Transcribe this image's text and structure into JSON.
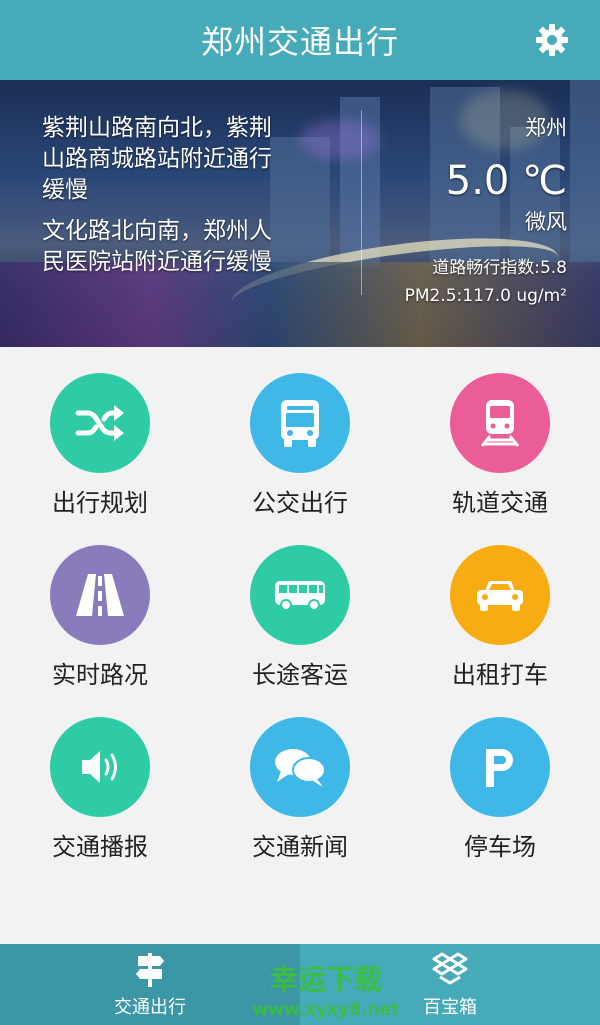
{
  "header": {
    "title": "郑州交通出行"
  },
  "banner": {
    "news": [
      "紫荆山路南向北，紫荆山路商城路站附近通行缓慢",
      "文化路北向南，郑州人民医院站附近通行缓慢"
    ],
    "weather": {
      "city": "郑州",
      "temperature": "5.0 ℃",
      "wind": "微风",
      "traffic_index": "道路畅行指数:5.8",
      "pm25": "PM2.5:117.0 ug/m²"
    }
  },
  "grid": {
    "items": [
      {
        "label": "出行规划",
        "icon": "shuffle-icon",
        "color": "#2ecba5"
      },
      {
        "label": "公交出行",
        "icon": "bus-front-icon",
        "color": "#3fb8e8"
      },
      {
        "label": "轨道交通",
        "icon": "train-icon",
        "color": "#ea5d97"
      },
      {
        "label": "实时路况",
        "icon": "road-icon",
        "color": "#8a7bbd"
      },
      {
        "label": "长途客运",
        "icon": "coach-bus-icon",
        "color": "#2ecba5"
      },
      {
        "label": "出租打车",
        "icon": "taxi-car-icon",
        "color": "#f7ac13"
      },
      {
        "label": "交通播报",
        "icon": "speaker-icon",
        "color": "#2ecba5"
      },
      {
        "label": "交通新闻",
        "icon": "chat-bubbles-icon",
        "color": "#3fb8e8"
      },
      {
        "label": "停车场",
        "icon": "parking-icon",
        "color": "#3fb8e8"
      }
    ]
  },
  "bottom_nav": {
    "items": [
      {
        "label": "交通出行",
        "icon": "signpost-icon"
      },
      {
        "label": "百宝箱",
        "icon": "dropbox-icon"
      }
    ]
  },
  "watermark": {
    "line1": "幸运下载",
    "line2": "www.xyxy8.net"
  }
}
